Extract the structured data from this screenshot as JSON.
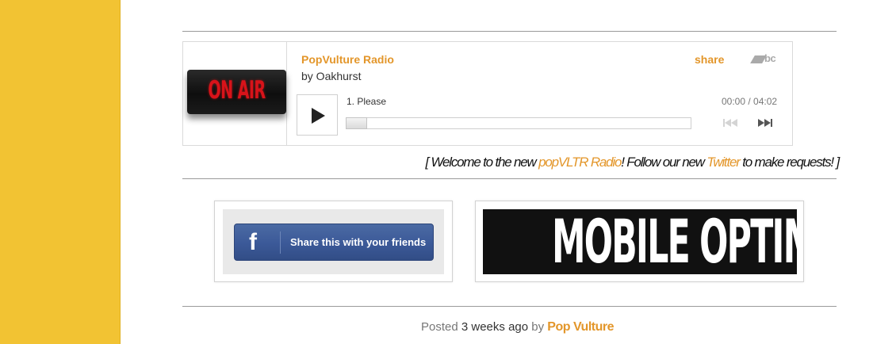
{
  "player": {
    "artwork_text": "ON AIR",
    "title": "PopVulture Radio",
    "by": "by Oakhurst",
    "share_label": "share",
    "brand_logo": "bc",
    "track": "1.  Please",
    "time": "00:00 / 04:02",
    "progress": 0,
    "icons": {
      "play": "play-icon",
      "prev": "skip-previous-icon",
      "next": "skip-next-icon"
    }
  },
  "welcome": {
    "open": "[ Welcome to the new ",
    "radio_link": "popVLTR Radio",
    "middle": "!  Follow our new ",
    "twitter_link": "Twitter",
    "close": " to make requests! ]"
  },
  "promo": {
    "facebook": {
      "icon_letter": "f",
      "label": "Share this with your friends"
    },
    "mobile": {
      "label": "MOBILE OPTIMIZED"
    }
  },
  "footer": {
    "posted": "Posted",
    "when": "3 weeks ago",
    "by": "by",
    "author": "Pop Vulture"
  },
  "colors": {
    "sidebar": "#f2c333",
    "accent": "#e3962a",
    "facebook": "#3b5998"
  }
}
